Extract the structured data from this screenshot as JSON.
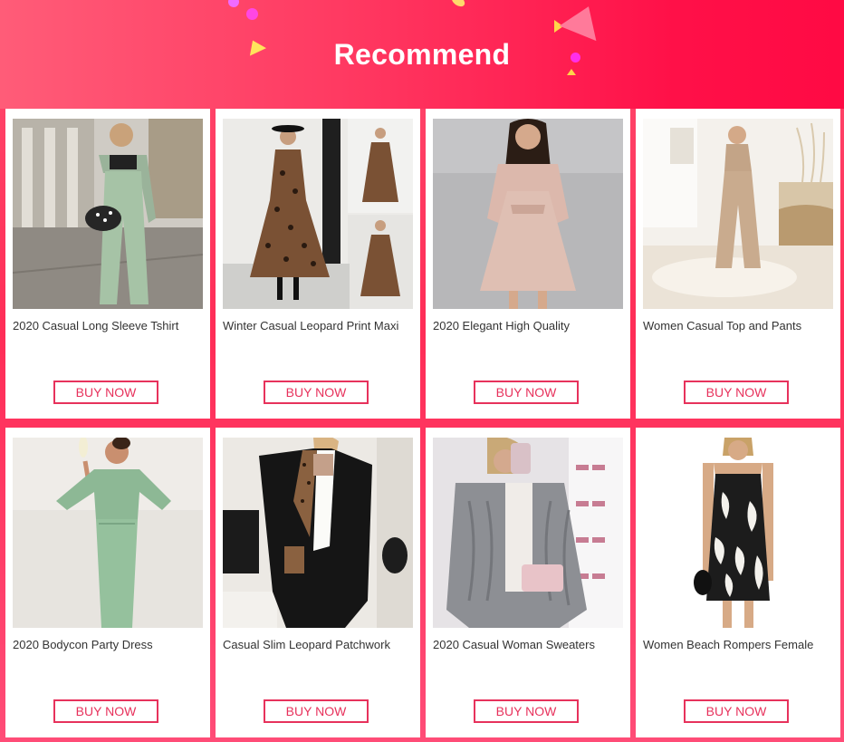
{
  "header": {
    "title": "Recommend"
  },
  "theme": {
    "accent": "#e7325c",
    "banner_start": "#ff5c78",
    "banner_end": "#ff0a44"
  },
  "products": [
    {
      "name": "2020 Casual Long Sleeve Tshirt",
      "button": "BUY NOW",
      "image": "woman-mint-green-outfit-street"
    },
    {
      "name": "Winter Casual Leopard Print Maxi",
      "button": "BUY NOW",
      "image": "woman-leopard-print-dress-collage"
    },
    {
      "name": "2020 Elegant High Quality",
      "button": "BUY NOW",
      "image": "woman-pink-wrap-dress"
    },
    {
      "name": "Women Casual Top and Pants",
      "button": "BUY NOW",
      "image": "woman-beige-top-pants-room"
    },
    {
      "name": "2020 Bodycon Party Dress",
      "button": "BUY NOW",
      "image": "woman-green-bodycon-dress"
    },
    {
      "name": "Casual Slim Leopard Patchwork",
      "button": "BUY NOW",
      "image": "woman-black-leopard-blazer"
    },
    {
      "name": "2020 Casual Woman Sweaters",
      "button": "BUY NOW",
      "image": "woman-gray-knit-cardigan"
    },
    {
      "name": "Women Beach Rompers Female",
      "button": "BUY NOW",
      "image": "black-white-leaf-print-romper"
    }
  ]
}
